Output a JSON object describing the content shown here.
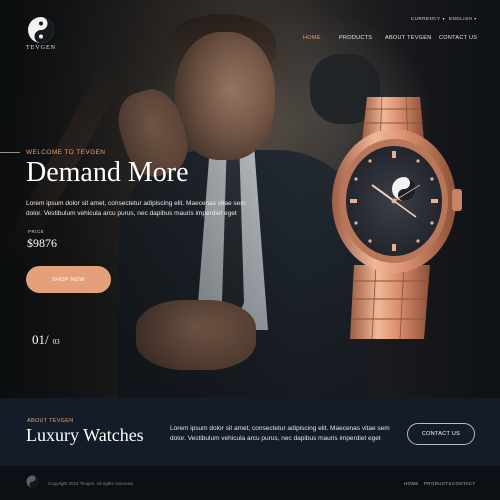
{
  "brand": {
    "name": "TEVGEN"
  },
  "topbar": {
    "currency": "CURRENCY",
    "language": "ENGLISH"
  },
  "nav": {
    "items": [
      "HOME",
      "PRODUCTS",
      "ABOUT TEVGEN",
      "CONTACT US"
    ],
    "active": "HOME"
  },
  "hero": {
    "welcome": "WELCOME TO TEVGEN",
    "headline": "Demand More",
    "description": "Lorem ipsum dolor sit amet, consectetur adipiscing elit. Maecenas vitae sem dolor. Vestibulum vehicula arcu purus, nec dapibus mauris imperdiet eget",
    "price_label": "PRICE",
    "price": "$9876",
    "shop_button": "SHOP NOW",
    "pager_current": "01/",
    "pager_total": "03"
  },
  "about": {
    "label": "ABOUT TEVGEN",
    "title": "Luxury Watches",
    "description": "Lorem ipsum dolor sit amet, consectetur adipiscing elit. Maecenas vitae sem dolor. Vestibulum vehicula arcu purus, nec dapibus mauris imperdiet eget",
    "contact_button": "CONTACT US"
  },
  "footer": {
    "copyright": "Copyright 2024 Tevgen. All rights reserved.",
    "links": [
      "HOME",
      "PRODUCTS",
      "CONTACT"
    ]
  },
  "colors": {
    "accent": "#e4a07a",
    "band": "#141c29",
    "footer": "#0c1015",
    "watch_gold": "#d9967a"
  },
  "icons": [
    "brand-logo-icon",
    "chevron-down-icon",
    "watch-image"
  ]
}
